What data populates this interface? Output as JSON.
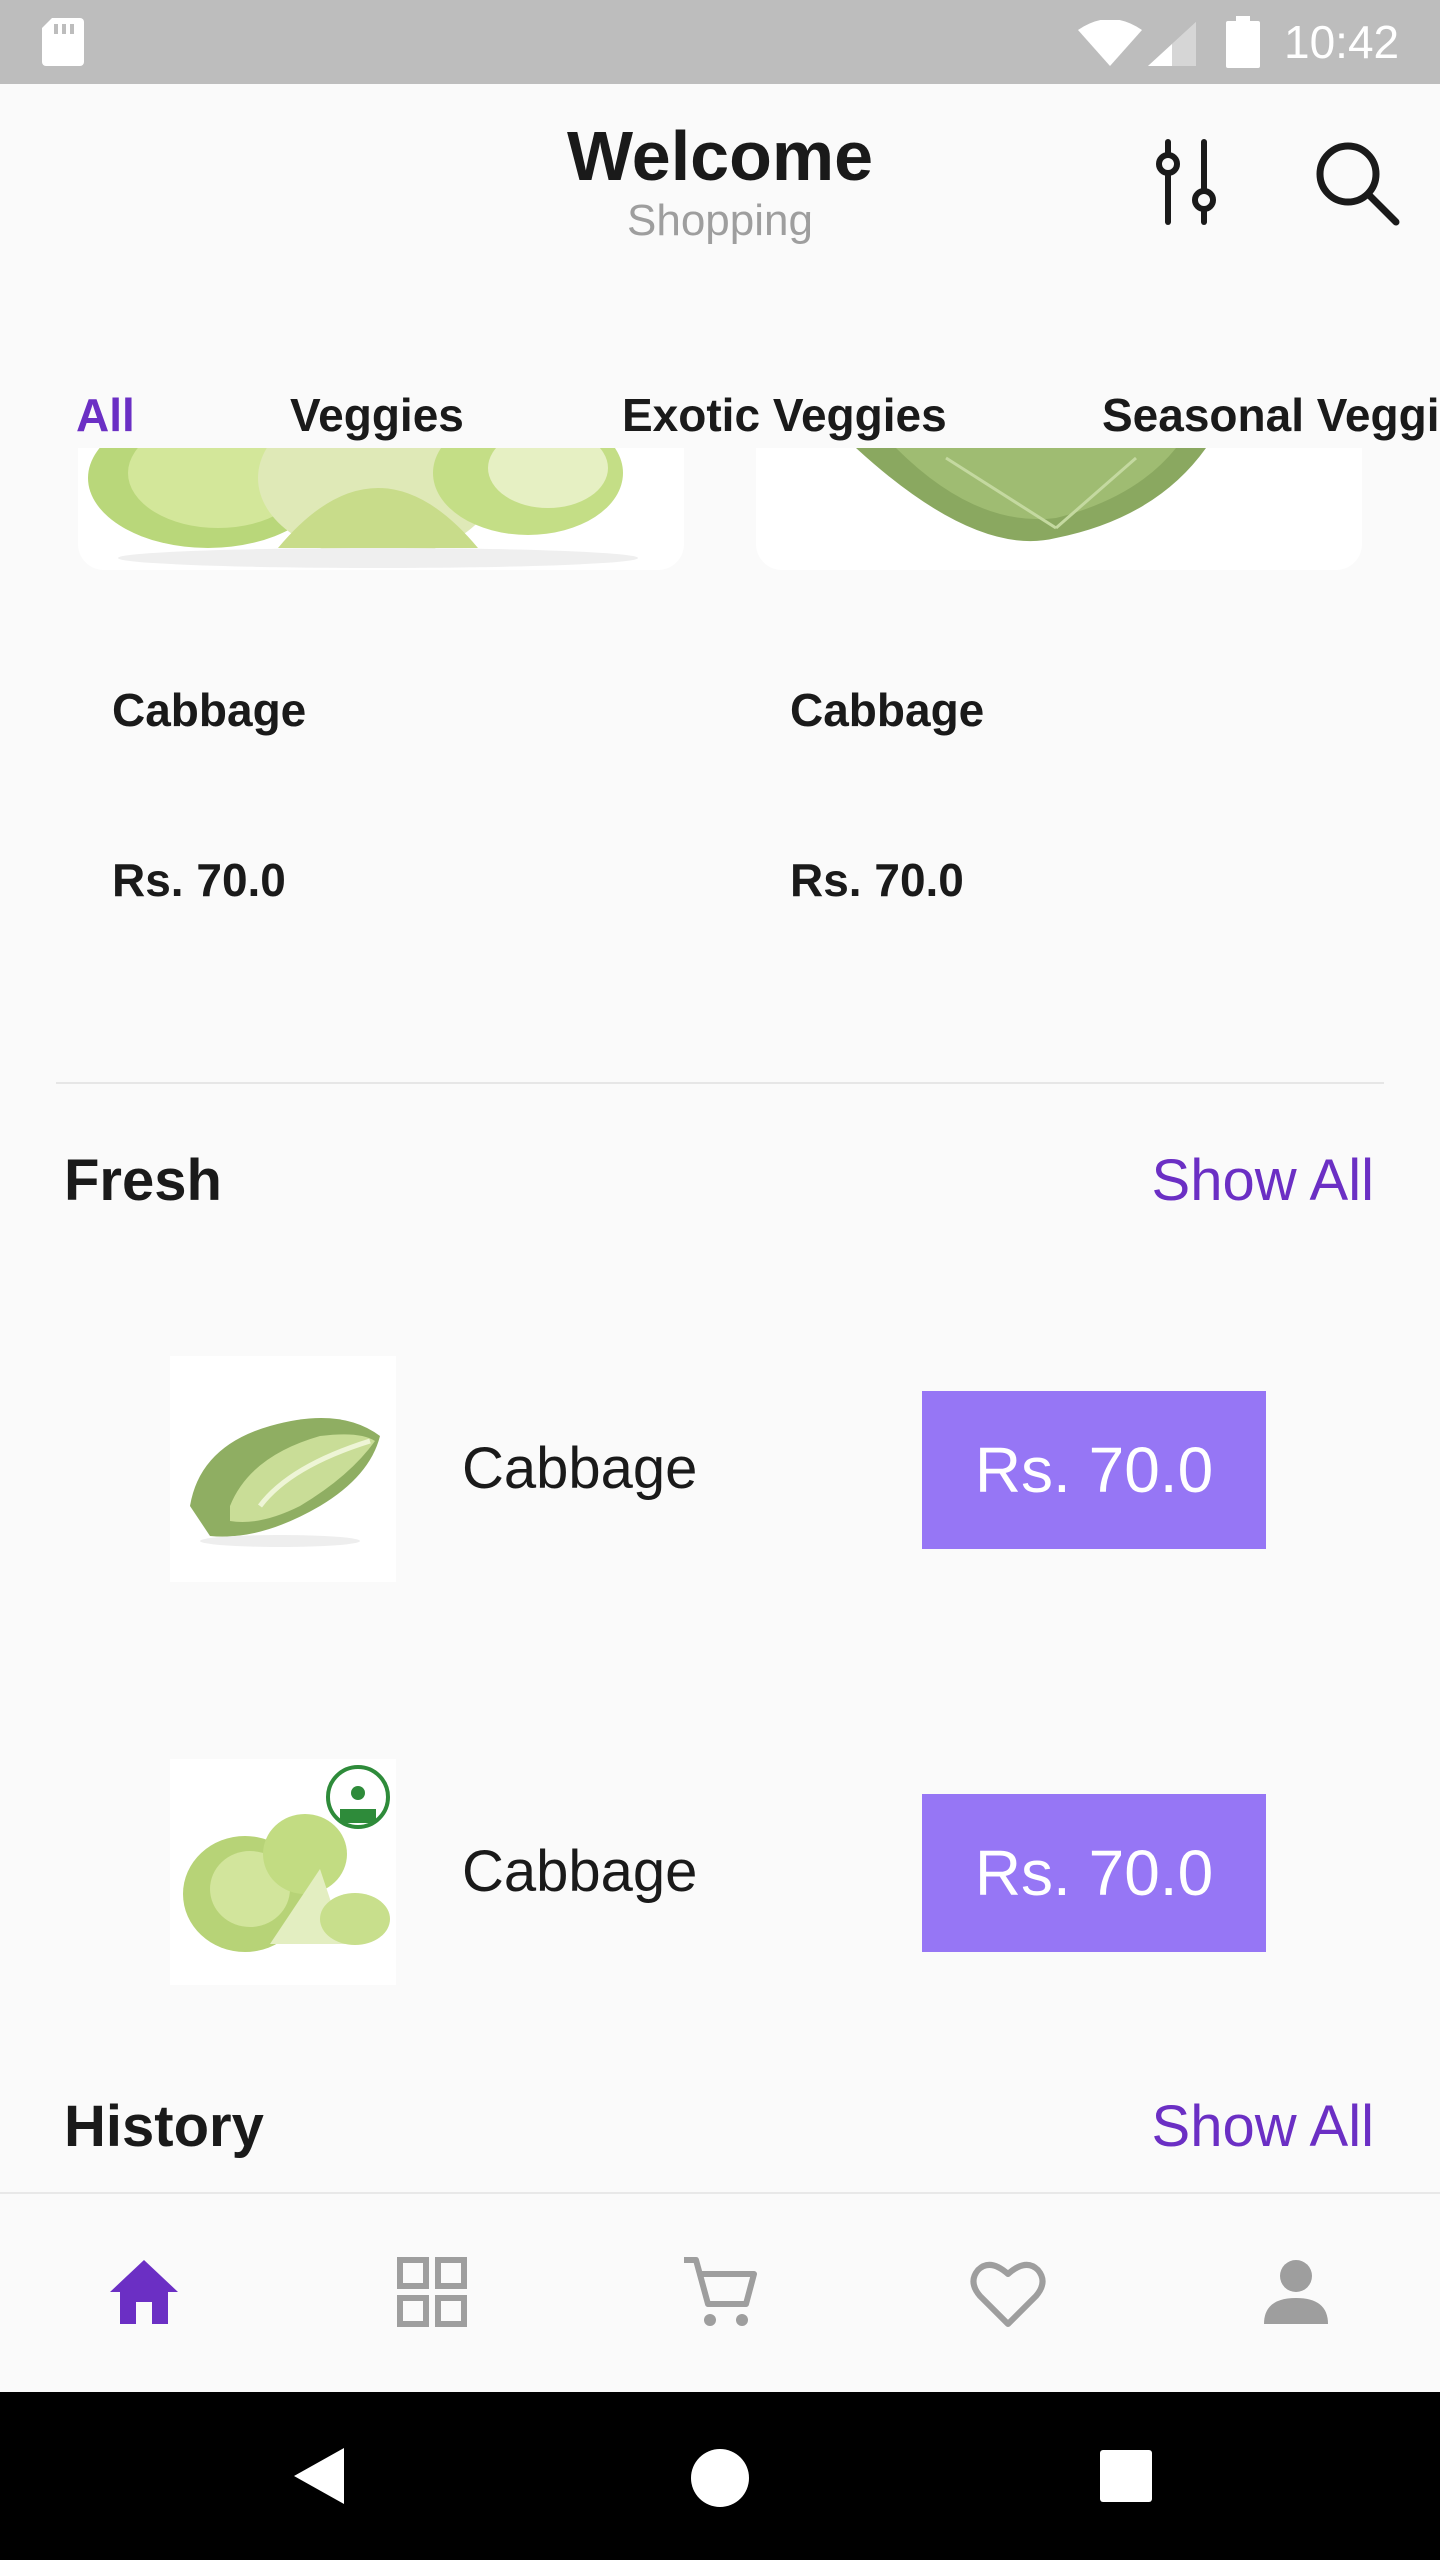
{
  "status_bar": {
    "time": "10:42",
    "icons": [
      "sd-card-icon",
      "wifi-icon",
      "signal-icon",
      "battery-icon"
    ]
  },
  "header": {
    "title": "Welcome",
    "subtitle": "Shopping",
    "icons": [
      "filter-icon",
      "search-icon"
    ]
  },
  "tabs": [
    {
      "label": "All",
      "active": true
    },
    {
      "label": "Veggies",
      "active": false
    },
    {
      "label": "Exotic Veggies",
      "active": false
    },
    {
      "label": "Seasonal Veggi",
      "active": false
    }
  ],
  "grid_products": [
    {
      "name": "Cabbage",
      "price": "Rs. 70.0"
    },
    {
      "name": "Cabbage",
      "price": "Rs. 70.0"
    }
  ],
  "fresh": {
    "title": "Fresh",
    "show_all": "Show All",
    "items": [
      {
        "name": "Cabbage",
        "price": "Rs. 70.0"
      },
      {
        "name": "Cabbage",
        "price": "Rs. 70.0"
      }
    ]
  },
  "history": {
    "title": "History",
    "show_all": "Show All"
  },
  "bottom_nav": [
    {
      "icon": "home-icon",
      "active": true
    },
    {
      "icon": "grid-icon",
      "active": false
    },
    {
      "icon": "cart-icon",
      "active": false
    },
    {
      "icon": "heart-icon",
      "active": false
    },
    {
      "icon": "person-icon",
      "active": false
    }
  ],
  "colors": {
    "accent": "#6b2fc4",
    "price_button": "#9676f5",
    "status_bar": "#bdbdbd",
    "inactive_icon": "#9e9e9e"
  }
}
